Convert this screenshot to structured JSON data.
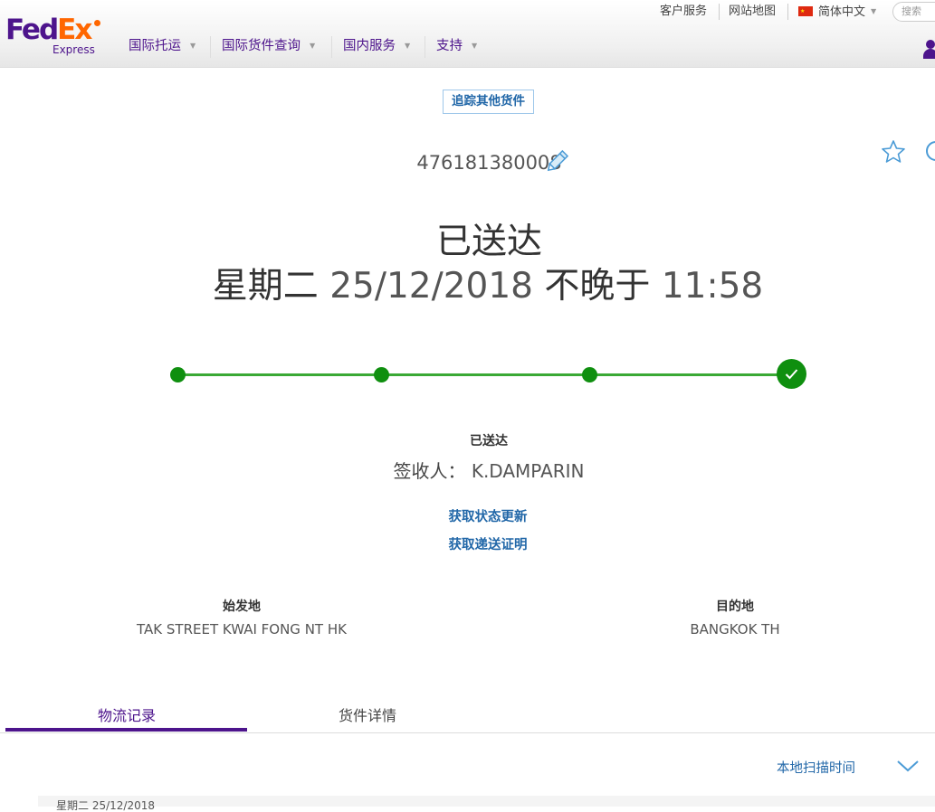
{
  "header": {
    "logo_main": "FedEx",
    "logo_fed": "Fed",
    "logo_ex": "Ex",
    "logo_sub": "Express",
    "utility": {
      "customer_service": "客户服务",
      "site_map": "网站地图",
      "language": "简体中文",
      "search_placeholder": "搜索"
    },
    "nav": [
      {
        "label": "国际托运"
      },
      {
        "label": "国际货件查询"
      },
      {
        "label": "国内服务"
      },
      {
        "label": "支持"
      }
    ]
  },
  "main": {
    "track_other_button": "追踪其他货件",
    "tracking_number": "476181380008",
    "status": "已送达",
    "delivery": {
      "weekday": "星期二",
      "date": "25/12/2018",
      "by_text": "不晚于",
      "time": "11:58"
    },
    "progress": {
      "steps_total": 4,
      "completed_steps": 4,
      "color": "#0f8f0f"
    },
    "status_label": "已送达",
    "signed_by_label": "签收人：",
    "signed_by": "K.DAMPARIN",
    "links": {
      "get_updates": "获取状态更新",
      "proof_of_delivery": "获取递送证明"
    },
    "origin": {
      "label": "始发地",
      "value": "TAK STREET KWAI FONG NT HK"
    },
    "destination": {
      "label": "目的地",
      "value": "BANGKOK TH"
    }
  },
  "tabs": [
    {
      "label": "物流记录",
      "active": true
    },
    {
      "label": "货件详情",
      "active": false
    }
  ],
  "history": {
    "scan_time_label": "本地扫描时间",
    "first_row_text": "星期二 25/12/2018"
  },
  "colors": {
    "brand_purple": "#4d148c",
    "brand_orange": "#ff6600",
    "link_blue": "#2167a8",
    "progress_green": "#0f8f0f"
  }
}
